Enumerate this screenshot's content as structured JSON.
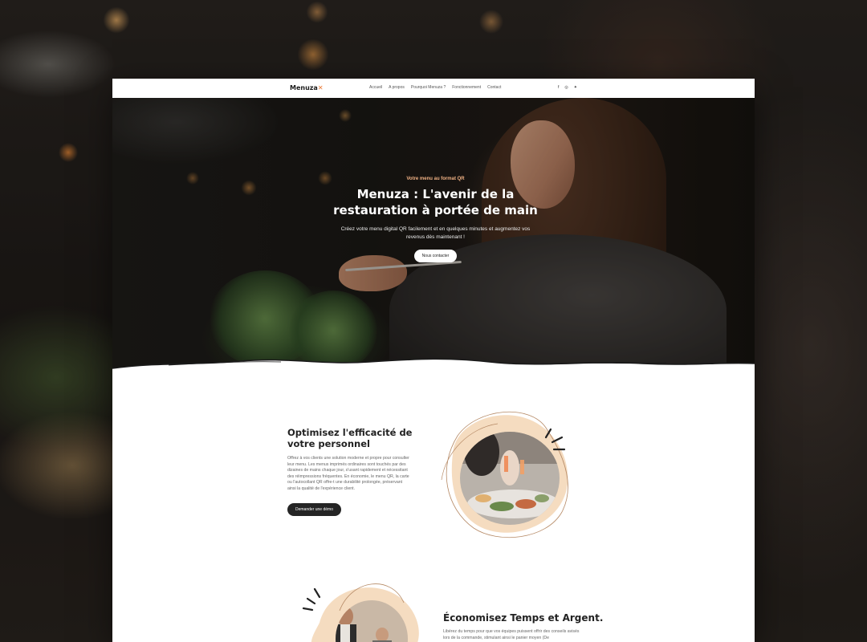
{
  "nav": {
    "logo": "Menuza",
    "logo_mark": "✕",
    "links": [
      "Accueil",
      "A propos",
      "Pourquoi Menuza ?",
      "Fonctionnement",
      "Contact"
    ],
    "social_icons": [
      "facebook-icon",
      "instagram-icon",
      "twitter-icon"
    ]
  },
  "hero": {
    "eyebrow": "Votre menu au format QR",
    "title": "Menuza : L'avenir de la restauration à portée de main",
    "subtitle": "Créez votre menu digital QR facilement et en quelques minutes et augmentez vos revenus dès maintenant !",
    "cta": "Nous contacter"
  },
  "section1": {
    "title": "Optimisez l'efficacité de votre personnel",
    "text": "Offrez à vos clients une solution moderne et propre pour consulter leur menu. Les menus imprimés ordinaires sont touchés par des dizaines de mains chaque jour, s'usant rapidement et nécessitant des réimpressions fréquentes. En économie, le menu QR, la carte ou l'autocollant QR offre-t une durabilité prolongée, préservant ainsi la qualité de l'expérience client.",
    "cta": "Demander une démo"
  },
  "section2": {
    "title": "Économisez Temps et Argent.",
    "text": "Libérez du temps pour que vos équipes puissent offrir des conseils avisés lors de la commande, stimulant ainsi le panier moyen (De"
  },
  "colors": {
    "accent": "#e9752f",
    "blob": "#f5dcc0",
    "dark_button": "#252525",
    "eyebrow": "#f0b184"
  }
}
